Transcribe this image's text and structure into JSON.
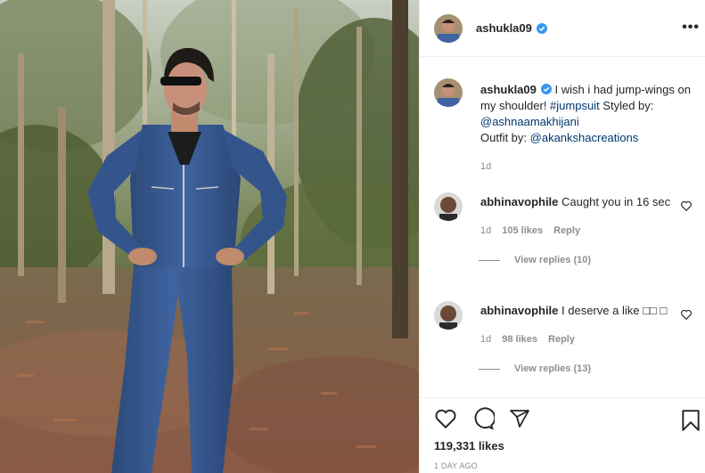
{
  "post": {
    "author": "ashukla09",
    "more_label": "•••"
  },
  "caption": {
    "username": "ashukla09",
    "text": " I wish i had jump-wings on my shoulder! ",
    "hashtag": "#jumpsuit",
    "styled_by": " Styled by: ",
    "stylist": "@ashnaamakhijani",
    "outfit_by": "Outfit by: ",
    "outfit": "@akankshacreations",
    "time": "1d"
  },
  "comments": [
    {
      "username": "abhinavophile",
      "text": " Caught you in 16 sec",
      "time": "1d",
      "likes": "105 likes",
      "reply": "Reply",
      "view_replies": "View replies (10)"
    },
    {
      "username": "abhinavophile",
      "text": " I deserve a like □□ □",
      "time": "1d",
      "likes": "98 likes",
      "reply": "Reply",
      "view_replies": "View replies (13)"
    }
  ],
  "actions": {
    "likes_count": "119,331 likes",
    "posted_ago": "1 DAY AGO"
  },
  "colors": {
    "verified": "#3897f0",
    "link": "#00376b",
    "muted": "#8e8e8e"
  },
  "icons": [
    "heart-icon",
    "comment-icon",
    "share-icon",
    "bookmark-icon",
    "verified-badge-icon",
    "more-options-icon"
  ]
}
